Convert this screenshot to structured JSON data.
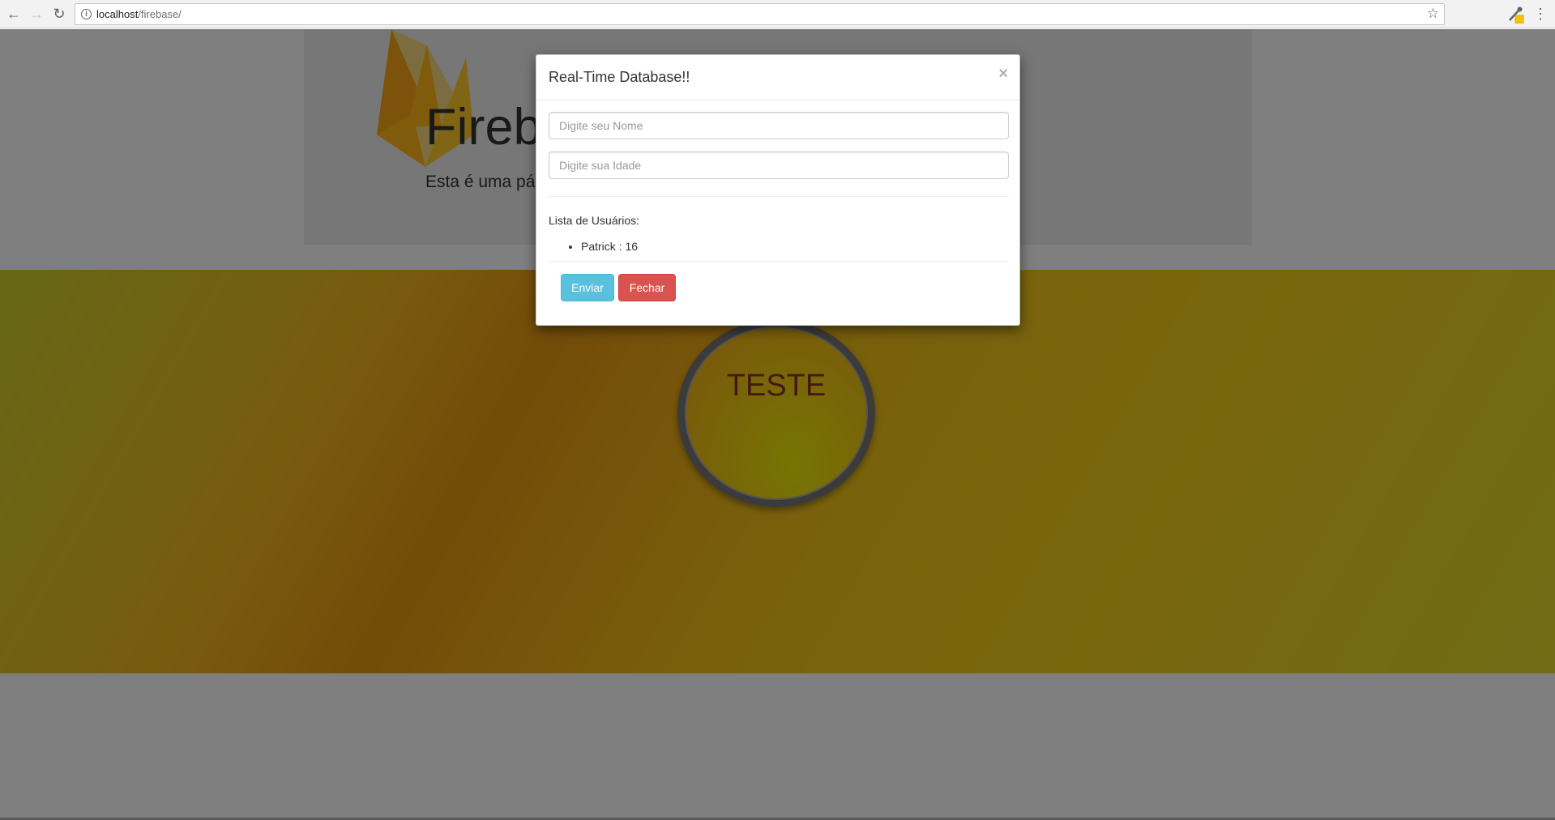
{
  "browser": {
    "url_host": "localhost",
    "url_path": "/firebase/",
    "icons": {
      "back": "back-arrow-icon",
      "forward": "forward-arrow-icon",
      "reload": "reload-icon",
      "info": "site-info-icon",
      "bookmark": "star-icon",
      "extension": "eyedropper-extension-icon",
      "menu": "kebab-menu-icon"
    }
  },
  "hero": {
    "title": "Firebase",
    "subtitle": "Esta é uma página"
  },
  "banner": {
    "lens_text": "TESTE"
  },
  "modal": {
    "title": "Real-Time Database!!",
    "close_label": "×",
    "name_placeholder": "Digite seu Nome",
    "age_placeholder": "Digite sua Idade",
    "list_heading": "Lista de Usuários:",
    "users": [
      {
        "label": "Patrick : 16"
      }
    ],
    "submit_label": "Enviar",
    "close_button_label": "Fechar"
  },
  "colors": {
    "info_button": "#5bc0de",
    "danger_button": "#d9534f",
    "firebase_orange": "#f6a623"
  }
}
